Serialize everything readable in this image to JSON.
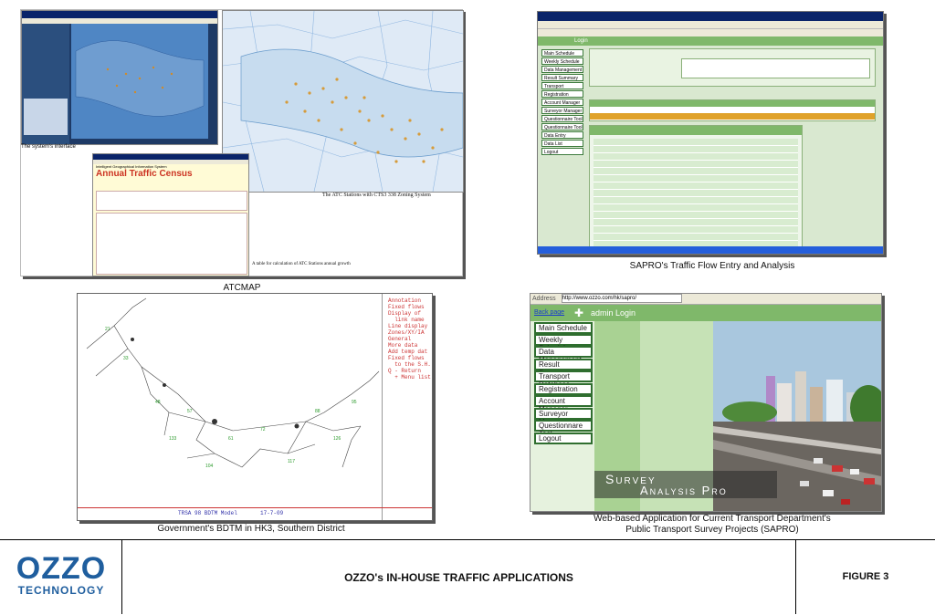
{
  "panels": {
    "atcmap": {
      "interface_caption": "The system's interface",
      "stations_caption": "The ATC Stations with CTS3 338 Zoning System",
      "table_caption": "A table for calculation of ATC Stations annual growth",
      "census_title": "Annual Traffic Census",
      "census_subtitle": "Intelligent Geographical Information System",
      "label": "ATCMAP"
    },
    "sapro_small": {
      "label": "SAPRO's Traffic Flow Entry and Analysis",
      "login_label": "Login",
      "nav_items": [
        "Main Schedule",
        "Weekly Schedule",
        "Data Management",
        "Result Summary",
        "Transport Database",
        "Registration",
        "Account Manager",
        "Surveyor Manager",
        "Questionnaire Tool",
        "Questionnaire Tool",
        "Data Entry",
        "Data List",
        "Logout"
      ]
    },
    "bdtm": {
      "label": "Government's BDTM in HK3, Southern District",
      "side_text": [
        "Annotation",
        "",
        "Fixed flows",
        "",
        "Display of",
        "  link name",
        "Line display",
        "Zones/XY/IA",
        "General",
        "",
        "More data",
        "",
        "Add temp dat",
        "Fixed flows",
        "  to the S.H.",
        "",
        "Q - Return",
        "",
        "  + Menu list"
      ],
      "footer_left": "TRSA 98 BDTM Model",
      "footer_right": "17-7-09"
    },
    "sapro_big": {
      "address_label": "Address",
      "address_url": "http://www.ozzo.com/hk/sapro/",
      "link_text": "Back page",
      "header_text": "admin Login",
      "menu": [
        "Main Schedule",
        "Weekly Schedule",
        "Data Management",
        "Result Summary",
        "Transport Database",
        "Registration",
        "Account Manager",
        "Surveyor Manager",
        "Questionnare Tool",
        "Logout"
      ],
      "banner_line1": "Survey",
      "banner_line2": "Analysis Pro",
      "caption_line1": "Web-based Application for Current Transport Department's",
      "caption_line2": "Public Transport Survey Projects (SAPRO)"
    }
  },
  "footer": {
    "logo_top": "OZZO",
    "logo_bottom": "TECHNOLOGY",
    "title": "OZZO's IN-HOUSE TRAFFIC APPLICATIONS",
    "figure": "FIGURE 3"
  },
  "colors": {
    "sapro_green": "#7fb86a",
    "nav_border": "#2f6e2f",
    "logo_blue": "#1f5e9e",
    "map_blue": "#9fd0ee"
  }
}
